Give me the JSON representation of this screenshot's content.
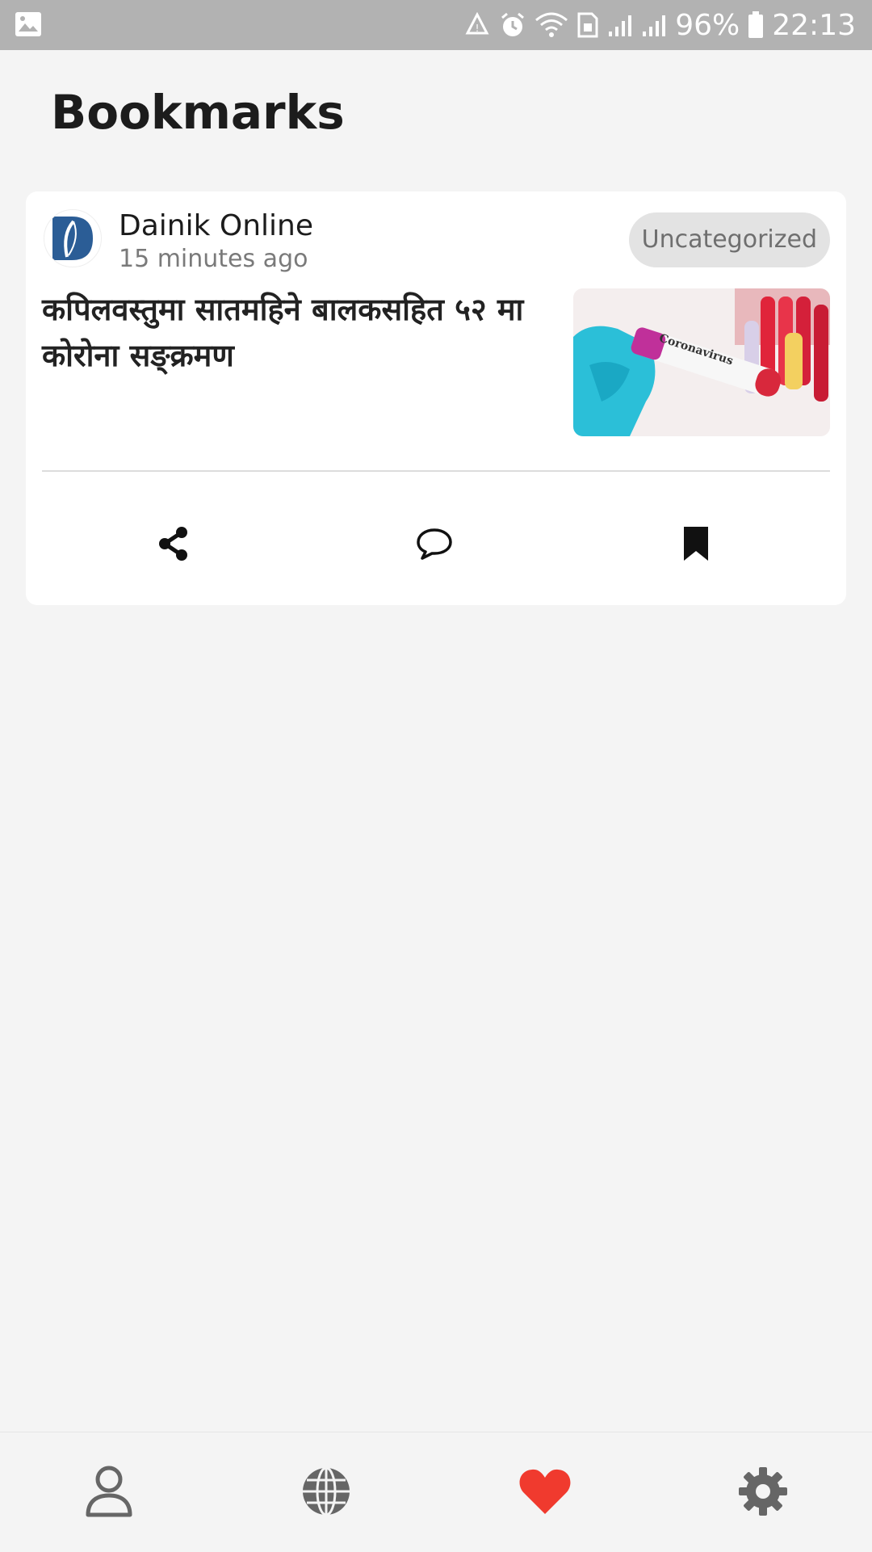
{
  "status_bar": {
    "battery": "96%",
    "time": "22:13",
    "icons": [
      "gallery-icon",
      "recycle-icon",
      "alarm-icon",
      "wifi-icon",
      "sim-icon",
      "signal-icon",
      "signal-icon",
      "battery-icon"
    ]
  },
  "page": {
    "title": "Bookmarks"
  },
  "article": {
    "source_name": "Dainik Online",
    "time_ago": "15 minutes ago",
    "category": "Uncategorized",
    "headline": "कपिलवस्तुमा सातमहिने बालकसहित ५२ मा कोरोना सङ्क्रमण",
    "thumbnail_label": "Coronavirus",
    "actions": [
      "share-icon",
      "comment-icon",
      "bookmark-icon"
    ]
  },
  "bottom_nav": {
    "items": [
      {
        "icon": "profile-icon",
        "active": false
      },
      {
        "icon": "globe-icon",
        "active": false
      },
      {
        "icon": "heart-icon",
        "active": true
      },
      {
        "icon": "gear-icon",
        "active": false
      }
    ]
  },
  "colors": {
    "status_bar": "#b2b2b2",
    "active": "#f03a2e",
    "inactive": "#666666",
    "logo_blue": "#2b5d96"
  }
}
